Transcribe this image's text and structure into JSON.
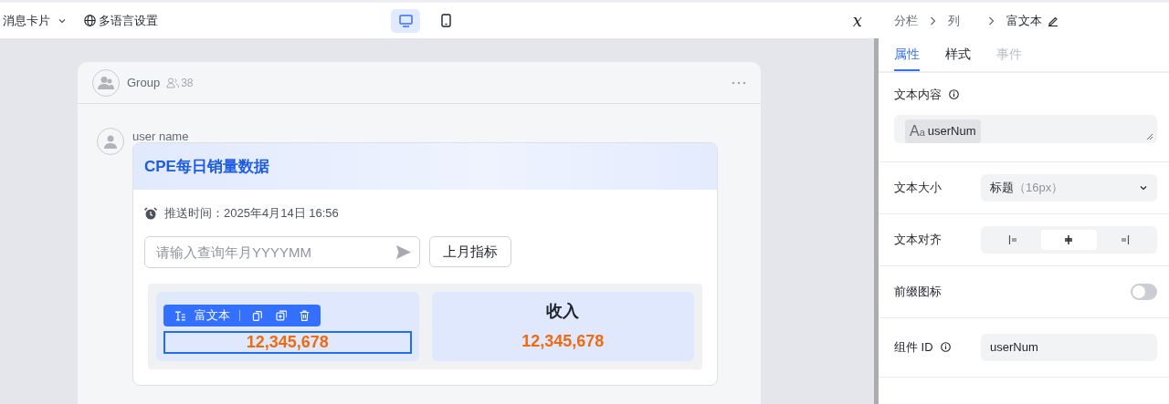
{
  "topbar": {
    "title": "消息卡片",
    "language_button": "多语言设置",
    "devices": [
      {
        "kind": "desktop",
        "selected": true
      },
      {
        "kind": "mobile",
        "selected": false
      }
    ],
    "variable_button": "𝑥"
  },
  "preview": {
    "group": {
      "name": "Group",
      "member_count": "38"
    },
    "message": {
      "sender": "user name",
      "card": {
        "title": "CPE每日销量数据",
        "push_time": "推送时间：2025年4月14日 16:56",
        "query_input": {
          "placeholder": "请输入查询年月YYYYMM"
        },
        "button": "上月指标",
        "tiles": [
          {
            "value": "12,345,678",
            "selected": true,
            "toolbar_label": "富文本"
          },
          {
            "label": "收入",
            "value": "12,345,678",
            "selected": false
          }
        ]
      }
    }
  },
  "panel": {
    "breadcrumb": [
      "分栏",
      "列",
      "富文本"
    ],
    "tabs": [
      {
        "label": "属性",
        "selected": true,
        "disabled": false
      },
      {
        "label": "样式",
        "selected": false,
        "disabled": false
      },
      {
        "label": "事件",
        "selected": false,
        "disabled": true
      }
    ],
    "properties": [
      {
        "kind": "textarea",
        "label": "文本内容",
        "info": true,
        "type_label": "Aa",
        "value": "userNum"
      },
      {
        "kind": "select",
        "label": "文本大小",
        "info": false,
        "value": "标题",
        "hint": "（16px）"
      },
      {
        "kind": "segmented",
        "label": "文本对齐",
        "info": false,
        "options": [
          {
            "kind": "left",
            "selected": false
          },
          {
            "kind": "center",
            "selected": true
          },
          {
            "kind": "right",
            "selected": false
          }
        ]
      },
      {
        "kind": "toggle",
        "label": "前缀图标",
        "info": false,
        "on": false
      },
      {
        "kind": "input",
        "label": "组件 ID",
        "info": true,
        "value": "userNum"
      }
    ]
  }
}
